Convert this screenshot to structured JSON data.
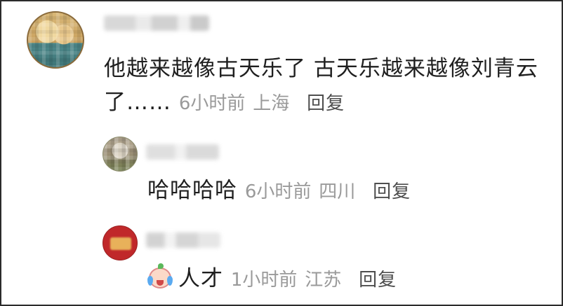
{
  "comments": {
    "main": {
      "text": "他越来越像古天乐了 古天乐越来越像刘青云了……",
      "time": "6小时前",
      "location": "上海",
      "reply_label": "回复"
    },
    "replies": [
      {
        "text": "哈哈哈哈",
        "time": "6小时前",
        "location": "四川",
        "reply_label": "回复"
      },
      {
        "emoji": "crying-laughing-emoji",
        "text": "人才",
        "time": "1小时前",
        "location": "江苏",
        "reply_label": "回复"
      }
    ]
  }
}
